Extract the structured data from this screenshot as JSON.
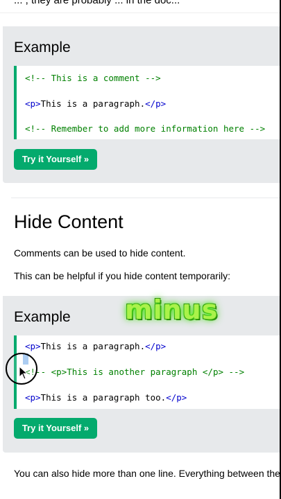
{
  "top_strip_text": "... , they are probably ... in the doc...",
  "example1": {
    "title": "Example",
    "code_lines": [
      {
        "comment": "<!-- This is a comment -->"
      },
      {
        "open": "<p>",
        "text": "This is a paragraph.",
        "close": "</p>"
      },
      {
        "comment": "<!-- Remember to add more information here -->"
      }
    ],
    "button": "Try it Yourself »"
  },
  "section": {
    "heading": "Hide Content",
    "p1": "Comments can be used to hide content.",
    "p2": "This can be helpful if you hide content temporarily:"
  },
  "example2": {
    "title": "Example",
    "line1": {
      "open": "<p>",
      "text": "This is a paragraph.",
      "close": "</p>"
    },
    "line2": {
      "comment_start": "<!-- ",
      "open": "<p>",
      "text": "This is another paragraph ",
      "close": "</p>",
      "comment_end": " -->"
    },
    "line3": {
      "open": "<p>",
      "text": "This is a paragraph too.",
      "close": "</p>"
    },
    "button": "Try it Yourself »"
  },
  "overlay_caption": "minus",
  "bottom_text": "You can also hide more than one line. Everything between the",
  "colors": {
    "accent": "#04aa6d",
    "comment": "#008000",
    "panel": "#e7e9eb",
    "caption": "#aaf24a"
  }
}
